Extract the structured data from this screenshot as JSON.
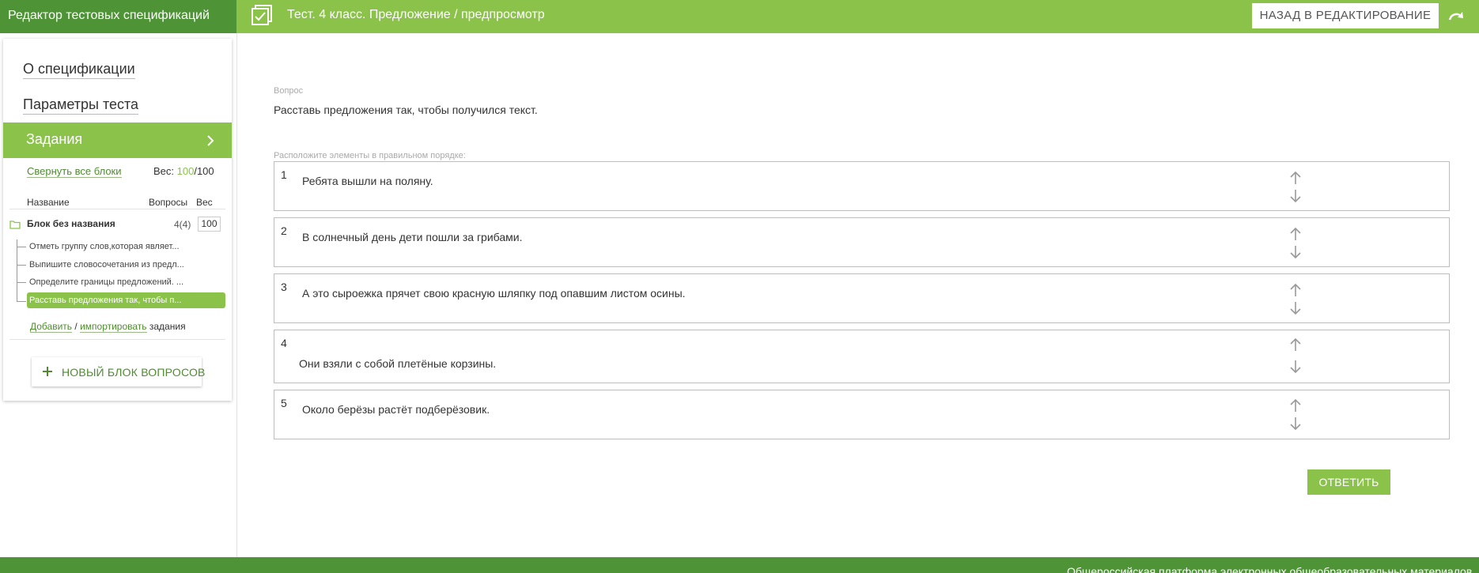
{
  "header": {
    "brand": "Редактор тестовых спецификаций",
    "title": "Тест. 4 класс. Предложение / предпросмотр",
    "back_label": "НАЗАД В РЕДАКТИРОВАНИЕ",
    "icons": [
      "document-check-icon",
      "redo-icon"
    ],
    "colors": {
      "accent": "#8bc34a",
      "brand": "#4e9436"
    }
  },
  "sidebar": {
    "nav": {
      "about": "О спецификации",
      "params": "Параметры теста",
      "tasks": "Задания"
    },
    "collapse_label": "Свернуть все блоки",
    "weight": {
      "label": "Вес: ",
      "current": "100",
      "total": "/100"
    },
    "columns": {
      "name": "Название",
      "questions": "Вопросы",
      "weight": "Вес"
    },
    "block": {
      "name": "Блок без названия",
      "count": "4(4)",
      "weight": "100",
      "items": [
        "Отметь группу слов,которая являет...",
        "Выпишите словосочетания из предл...",
        "Определите границы предложений. ...",
        "Расставь предложения так, чтобы п..."
      ]
    },
    "add": {
      "add_label": "Добавить",
      "separator": " / ",
      "import_label": "импортировать",
      "suffix": " задания"
    },
    "new_block_label": "НОВЫЙ БЛОК ВОПРОСОВ"
  },
  "main": {
    "question_caption": "Вопрос",
    "question_text": "Расставь предложения так, чтобы получился текст.",
    "order_caption": "Расположите элементы в правильном порядке:",
    "items": [
      {
        "num": "1",
        "text": "Ребята вышли на поляну."
      },
      {
        "num": "2",
        "text": "В солнечный день дети пошли за грибами."
      },
      {
        "num": "3",
        "text": "А это сыроежка прячет свою красную шляпку под опавшим листом осины."
      },
      {
        "num": "4",
        "text": "Они взяли с собой плетёные корзины."
      },
      {
        "num": "5",
        "text": "Около берёзы растёт подберёзовик."
      }
    ],
    "answer_label": "ОТВЕТИТЬ"
  },
  "footer": {
    "text": "Общероссийская платформа электронных общеобразовательных материалов"
  }
}
